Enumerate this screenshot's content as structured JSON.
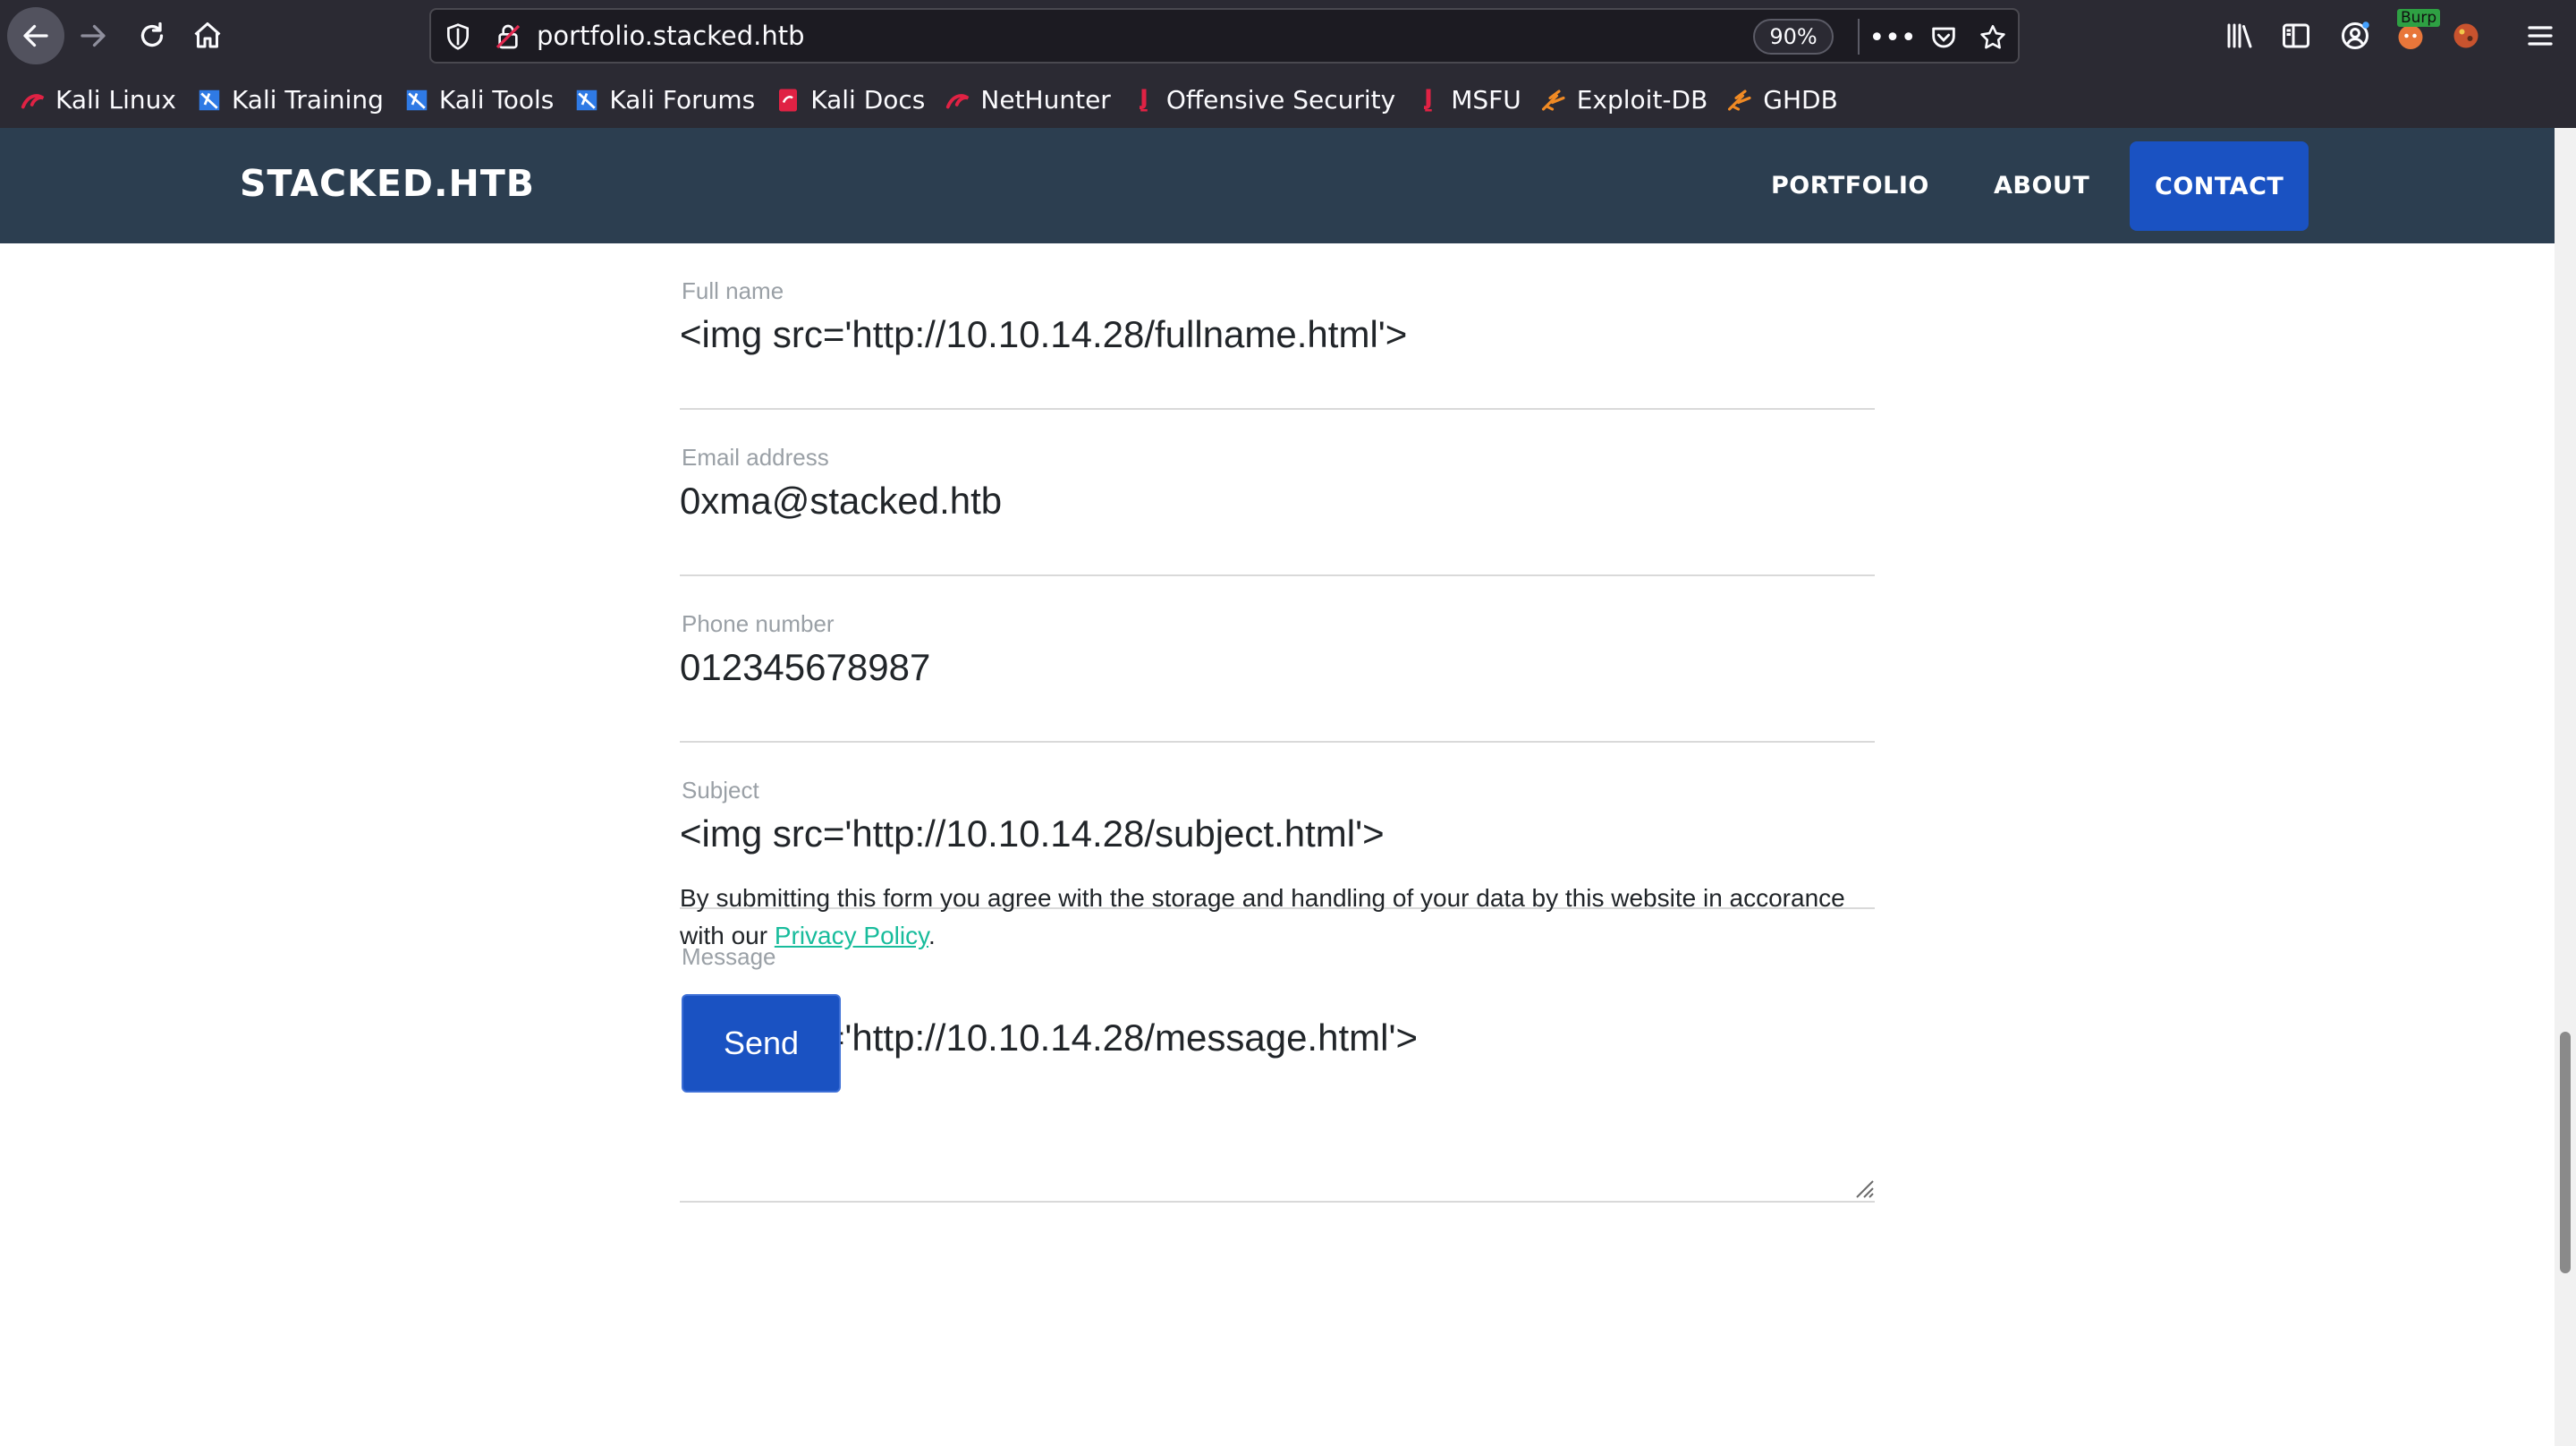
{
  "browser": {
    "url": "portfolio.stacked.htb",
    "zoom": "90%",
    "burp_badge": "Burp",
    "bookmarks": [
      {
        "label": "Kali Linux",
        "icon": "kali-dragon-icon"
      },
      {
        "label": "Kali Training",
        "icon": "kali-training-icon"
      },
      {
        "label": "Kali Tools",
        "icon": "kali-tools-icon"
      },
      {
        "label": "Kali Forums",
        "icon": "kali-forums-icon"
      },
      {
        "label": "Kali Docs",
        "icon": "kali-docs-icon"
      },
      {
        "label": "NetHunter",
        "icon": "nethunter-icon"
      },
      {
        "label": "Offensive Security",
        "icon": "offsec-icon"
      },
      {
        "label": "MSFU",
        "icon": "msfu-icon"
      },
      {
        "label": "Exploit-DB",
        "icon": "exploitdb-icon"
      },
      {
        "label": "GHDB",
        "icon": "ghdb-icon"
      }
    ]
  },
  "site": {
    "brand": "STACKED.HTB",
    "nav": {
      "portfolio": "PORTFOLIO",
      "about": "ABOUT",
      "contact": "CONTACT"
    },
    "colors": {
      "navbar": "#2c3e50",
      "primary": "#1a52c2",
      "link": "#18bc9c"
    }
  },
  "form": {
    "fullname": {
      "label": "Full name",
      "value": "<img src='http://10.10.14.28/fullname.html'>"
    },
    "email": {
      "label": "Email address",
      "value": "0xma@stacked.htb"
    },
    "phone": {
      "label": "Phone number",
      "value": "012345678987"
    },
    "subject": {
      "label": "Subject",
      "value": "<img src='http://10.10.14.28/subject.html'>"
    },
    "message": {
      "label": "Message",
      "value": "<img src='http://10.10.14.28/message.html'>"
    },
    "consent_text": "By submitting this form you agree with the storage and handling of your data by this website in accorance with our ",
    "privacy_link": "Privacy Policy",
    "consent_end": ".",
    "send_label": "Send"
  }
}
